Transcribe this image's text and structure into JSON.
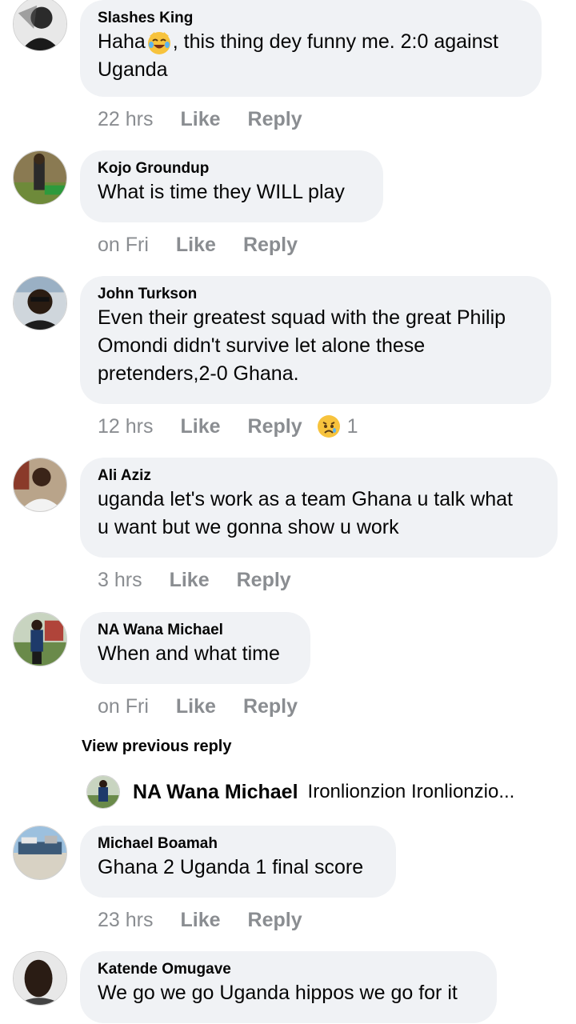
{
  "comments": [
    {
      "author": "Slashes King",
      "text_before_emoji": "Haha",
      "emoji": "grinning-cat-with-tears",
      "text_after_emoji": ", this thing dey funny me. 2:0 against",
      "text_line2": "Uganda",
      "time": "22 hrs",
      "like": "Like",
      "reply": "Reply"
    },
    {
      "author": "Kojo Groundup",
      "text": "What is time they WILL play",
      "time": "on Fri",
      "like": "Like",
      "reply": "Reply"
    },
    {
      "author": "John Turkson",
      "text_lines": [
        "Even their greatest squad with the great Philip",
        "Omondi didn't survive let alone these",
        "pretenders,2-0 Ghana."
      ],
      "time": "12 hrs",
      "like": "Like",
      "reply": "Reply",
      "reaction": {
        "icon": "sad-reaction-icon",
        "count": "1"
      }
    },
    {
      "author": "Ali Aziz",
      "text_lines": [
        "uganda let's work as a team Ghana u talk what",
        "u want but we gonna show u work"
      ],
      "time": "3 hrs",
      "like": "Like",
      "reply": "Reply"
    },
    {
      "author": "NA Wana Michael",
      "text": "When and what time",
      "time": "on Fri",
      "like": "Like",
      "reply": "Reply"
    },
    {
      "author": "Michael Boamah",
      "text": "Ghana 2 Uganda 1 final score",
      "time": "23 hrs",
      "like": "Like",
      "reply": "Reply"
    },
    {
      "author": "Katende Omugave",
      "text": "We go we go Uganda hippos we go for it"
    }
  ],
  "view_previous": "View previous reply",
  "reply_preview": {
    "author": "NA Wana Michael",
    "text": "Ironlionzion Ironlionzio..."
  },
  "colors": {
    "bubble": "#f0f2f5",
    "meta": "#8a8d91",
    "text": "#050505"
  }
}
